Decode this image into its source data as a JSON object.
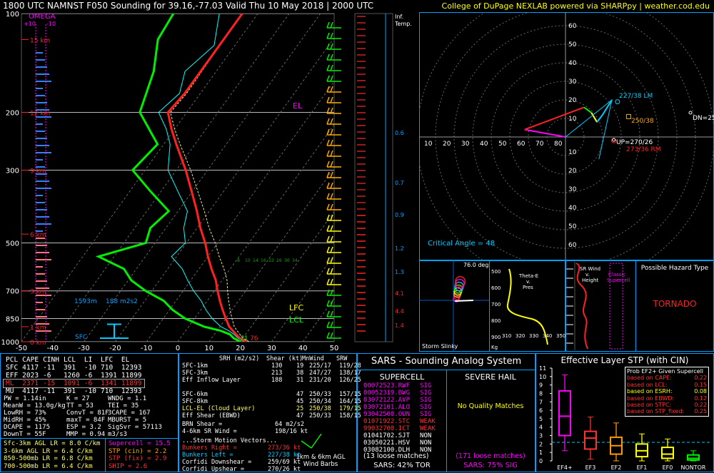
{
  "header": {
    "title": "1800 UTC NAMNST F050 Sounding for 39.16,-77.03 Valid  Thu 10 May 2018 | 2000 UTC",
    "credit": "College of DuPage NEXLAB powered via SHARPpy | weather.cod.edu"
  },
  "skewt": {
    "omega_label": "OMEGA",
    "omega_ticks": [
      "+10",
      "-10"
    ],
    "pressure_ticks": [
      "100",
      "200",
      "300",
      "500",
      "700",
      "850",
      "1000"
    ],
    "temp_ticks": [
      "-50",
      "-40",
      "-30",
      "-20",
      "-10",
      "0",
      "10",
      "20",
      "30",
      "40",
      "50"
    ],
    "height_labels": [
      "15 km",
      "12 km",
      "9 km",
      "6 km",
      "3 km",
      "1 km",
      "0 km"
    ],
    "mixing_ratio_labels": [
      "8",
      "10",
      "14",
      "16",
      "22",
      "26",
      "30",
      "34"
    ],
    "labels": {
      "el": "EL",
      "lfc": "LFC",
      "lcl": "LCL",
      "sfc": "SFC",
      "eff_bottom": "1593m",
      "eff_srh": "188 m2s2",
      "sfc_t": "71",
      "sfc_td": "76"
    },
    "colors": {
      "temp": "#ff2020",
      "dewpoint": "#00ee00",
      "virtual": "#ff8080",
      "wetbulb": "#00ffff",
      "parcel": "#e8e8a0"
    },
    "chart_data": {
      "type": "line",
      "xlabel": "",
      "ylabel": "",
      "series": [
        {
          "name": "",
          "type": "temperature",
          "p": [
            1000,
            975,
            950,
            925,
            900,
            850,
            800,
            750,
            700,
            650,
            600,
            550,
            500,
            450,
            400,
            350,
            300,
            250,
            225,
            200,
            175,
            150,
            125,
            100
          ],
          "t": [
            22,
            19,
            17,
            15,
            13,
            10,
            7,
            4,
            1,
            -2,
            -6,
            -10,
            -14,
            -19,
            -24,
            -30,
            -37,
            -46,
            -51,
            -56,
            -55,
            -55,
            -55,
            -55
          ]
        },
        {
          "name": "",
          "type": "dewpoint",
          "p": [
            1000,
            975,
            950,
            925,
            900,
            850,
            800,
            750,
            700,
            650,
            600,
            550,
            500,
            450,
            400,
            350,
            300,
            250,
            200,
            150,
            120,
            100
          ],
          "t": [
            20,
            17,
            15,
            11,
            5,
            -3,
            -9,
            -14,
            -22,
            -29,
            -34,
            -45,
            -33,
            -35,
            -33,
            -43,
            -54,
            -52,
            -65,
            -70,
            -76,
            -77
          ]
        }
      ],
      "ylim": [
        1000,
        100
      ],
      "xlim": [
        -50,
        50
      ],
      "log_y": true
    },
    "srw_ticks": [
      "0.6",
      "0.7",
      "0.9",
      "1.2",
      "1.3",
      "4.1",
      "4.4",
      "1.4"
    ],
    "inf_temp": [
      "Inf.",
      "Temp."
    ]
  },
  "hodograph": {
    "ring_labels_x": [
      "10",
      "20",
      "30",
      "40",
      "50",
      "60",
      "70",
      "80"
    ],
    "ring_labels_y": [
      "60",
      "50",
      "40",
      "30",
      "20",
      "10",
      "10",
      "20",
      "30",
      "40",
      "50",
      "60"
    ],
    "lm_label": "227/38 LM",
    "rm_label": "273/36 RM",
    "dn_label": "DN=25",
    "up_label": "UP=270/26",
    "mean_label": "250/38",
    "critical_angle": "Critical Angle = 48",
    "chart_data": {
      "type": "line",
      "u": [
        0,
        -22,
        10,
        14,
        17,
        20,
        25
      ],
      "v": [
        0,
        4,
        16,
        13,
        8,
        12,
        20
      ]
    }
  },
  "slinky": {
    "title": "Storm Slinky",
    "angle": "76.0 deg"
  },
  "theta": {
    "title": "Theta-E v. Pres",
    "p_ticks": [
      "500",
      "600",
      "700",
      "800",
      "900"
    ],
    "x_ticks": [
      "310",
      "320",
      "330",
      "340",
      "350"
    ],
    "x_prefix": "Kg"
  },
  "srwind": {
    "title": "SR Wind v. Height",
    "classic": "Classic Supercell"
  },
  "hazard": {
    "title": "Possible Hazard Type",
    "value": "TORNADO"
  },
  "params": {
    "header": [
      "PCL",
      "CAPE",
      "CINH",
      "LCL",
      "LI",
      "LFC",
      "EL"
    ],
    "rows": [
      [
        "SFC",
        "4117",
        "-11",
        "391",
        "-10",
        "710",
        "12393"
      ],
      [
        "EFF",
        "2023",
        "-6",
        "1260",
        "-6",
        "1391",
        "11899"
      ],
      [
        "ML",
        "2371",
        "-15",
        "1091",
        "-6",
        "1341",
        "11899"
      ],
      [
        "MU",
        "4117",
        "-11",
        "391",
        "-10",
        "710",
        "12393"
      ]
    ],
    "col1": [
      "PW = 1.14in",
      "MeanW = 13.0g/kg",
      "LowRH = 73%",
      "MidRH = 45%",
      "DCAPE = 1175",
      "DownT = 55F"
    ],
    "col2": [
      "K = 27",
      "TT = 53",
      "ConvT = 81F",
      "maxT = 84F",
      "ESP = 3.2",
      "MMP = 0.94"
    ],
    "col3": [
      "WNDG = 1.1",
      "TEI = 35",
      "3CAPE = 167",
      "MBURST = 5",
      "",
      "SigSvr = 57113 m3/s3"
    ],
    "lapse": [
      "Sfc-3km AGL LR = 8.0 C/km",
      "3-6km AGL LR = 6.4 C/km",
      "850-500mb LR = 6.8 C/km",
      "700-500mb LR = 6.4 C/km"
    ],
    "composite": [
      "Supercell = 15.5",
      "STP (cin) = 2.2",
      "STP (fix) = 2.9",
      "SHIP = 2.6"
    ]
  },
  "kinematics": {
    "header": [
      "SRH (m2/s2)",
      "Shear (kt)",
      "MnWind",
      "SRW"
    ],
    "rows": [
      [
        "SFC-1km",
        "130",
        "19",
        "225/17",
        "119/28"
      ],
      [
        "SFC-3km",
        "213",
        "38",
        "247/27",
        "138/17"
      ],
      [
        "Eff Inflow Layer",
        "188",
        "31",
        "231/20",
        "126/25"
      ],
      [
        "",
        "",
        "",
        "",
        ""
      ],
      [
        "SFC-6km",
        "",
        "47",
        "250/33",
        "157/15"
      ],
      [
        "SFC-8km",
        "",
        "45",
        "250/34",
        "164/15"
      ],
      [
        "LCL-EL (Cloud Layer)",
        "",
        "25",
        "250/38",
        "179/15"
      ],
      [
        "Eff Shear (EBWD)",
        "",
        "47",
        "250/33",
        "158/15"
      ]
    ],
    "brn_shear": [
      "BRN Shear =",
      "64 m2/s2"
    ],
    "srw_4_6": [
      "4-6km SR Wind =",
      "198/16 kt"
    ],
    "motion_title": "...Storm Motion Vectors...",
    "motions": [
      [
        "Bunkers Right =",
        "273/36 kt"
      ],
      [
        "Bunkers Left =",
        "227/38 kt"
      ],
      [
        "Corfidi Downshear =",
        "259/69 kt"
      ],
      [
        "Corfidi Upshear =",
        "270/26 kt"
      ]
    ],
    "barbs_label": [
      "1km & 6km AGL",
      "Wind Barbs"
    ]
  },
  "sars": {
    "title": "SARS - Sounding Analog System",
    "supercell_head": "SUPERCELL",
    "hail_head": "SEVERE HAIL",
    "matches": [
      [
        "00072523.RWF",
        "SIG"
      ],
      [
        "00052319.BWG",
        "SIG"
      ],
      [
        "03072122.AVP",
        "SIG"
      ],
      [
        "03072101.ALO",
        "SIG"
      ],
      [
        "93042500.OUN",
        "SIG"
      ],
      [
        "01071922.STC",
        "WEAK"
      ],
      [
        "99032700.ICT",
        "WEAK"
      ],
      [
        "01041702.SJT",
        "NON"
      ],
      [
        "03050221.HSV",
        "NON"
      ],
      [
        "03082100.DLH",
        "NON"
      ]
    ],
    "loose_left": "(13 loose matches)",
    "loose_right": "(171 loose matches)",
    "no_match": "No Quality Matches",
    "tor": "SARS: 42% TOR",
    "sig": "SARS: 75% SIG"
  },
  "stp": {
    "title": "Effective Layer STP (with CIN)",
    "prob_title": "Prob EF2+ Given Supercell",
    "probs": [
      [
        "based on CAPE:",
        "0.22"
      ],
      [
        "based on LCL:",
        "0.15"
      ],
      [
        "based on ESRH:",
        "0.08"
      ],
      [
        "based on EBWD:",
        "0.12"
      ],
      [
        "based on STPC:",
        "0.22"
      ],
      [
        "based on STP_fixed:",
        "0.25"
      ]
    ],
    "y_ticks": [
      "11",
      "10",
      "9",
      "8",
      "7",
      "6",
      "5",
      "4",
      "3",
      "2",
      "1",
      "0"
    ],
    "categories": [
      "EF4+",
      "EF3",
      "EF2",
      "EF1",
      "EF0",
      "NONTOR"
    ],
    "chart_data": {
      "type": "bar",
      "categories": [
        "EF4+",
        "EF3",
        "EF2",
        "EF1",
        "EF0",
        "NONTOR"
      ],
      "boxes": [
        {
          "lo": 1.2,
          "q1": 3.0,
          "med": 5.3,
          "q3": 8.3,
          "hi": 10.2,
          "color": "#ff00ff"
        },
        {
          "lo": 0.2,
          "q1": 1.4,
          "med": 2.7,
          "q3": 3.5,
          "hi": 5.2,
          "color": "#ff3030"
        },
        {
          "lo": 0.0,
          "q1": 0.8,
          "med": 1.8,
          "q3": 2.8,
          "hi": 4.5,
          "color": "#ff9900"
        },
        {
          "lo": 0.0,
          "q1": 0.5,
          "med": 1.2,
          "q3": 2.0,
          "hi": 3.2,
          "color": "#ffff00"
        },
        {
          "lo": 0.0,
          "q1": 0.3,
          "med": 0.8,
          "q3": 1.6,
          "hi": 2.6,
          "color": "#ffff00"
        },
        {
          "lo": 0.0,
          "q1": 0.1,
          "med": 0.3,
          "q3": 0.7,
          "hi": 1.2,
          "color": "#00ee00"
        }
      ],
      "ylim": [
        0,
        11
      ],
      "current_value": 2.2
    }
  }
}
